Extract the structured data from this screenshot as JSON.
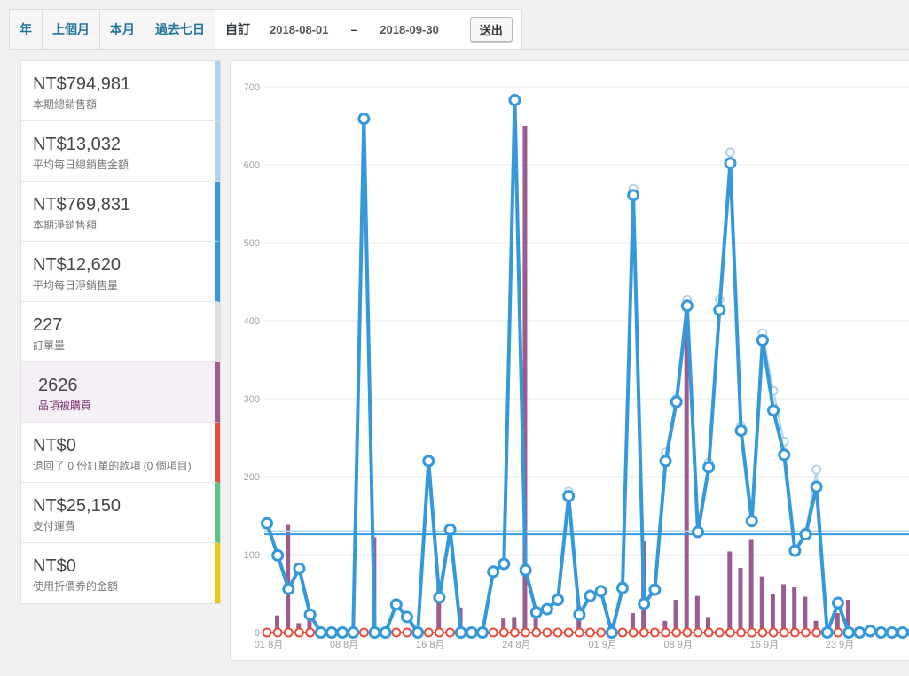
{
  "range_tabs": [
    "年",
    "上個月",
    "本月",
    "過去七日"
  ],
  "custom": {
    "label": "自訂",
    "start_date": "2018-08-01",
    "separator": "–",
    "end_date": "2018-09-30",
    "submit_label": "送出"
  },
  "legend": [
    {
      "value": "NT$794,981",
      "label": "本期總銷售額",
      "color": "#b1d4ea"
    },
    {
      "value": "NT$13,032",
      "label": "平均每日總銷售金額",
      "color": "#b1d4ea"
    },
    {
      "value": "NT$769,831",
      "label": "本期淨銷售額",
      "color": "#3498db"
    },
    {
      "value": "NT$12,620",
      "label": "平均每日淨銷售量",
      "color": "#3498db"
    },
    {
      "value": "227",
      "label": "訂單量",
      "color": "#dbe1e3"
    },
    {
      "value": "2626",
      "label": "品項被購買",
      "color": "#9b5c8f",
      "active": true
    },
    {
      "value": "NT$0",
      "label": "退回了 0 份訂單的款項 (0 個項目)",
      "color": "#e74c3c"
    },
    {
      "value": "NT$25,150",
      "label": "支付運費",
      "color": "#5cc488"
    },
    {
      "value": "NT$0",
      "label": "使用折價券的金額",
      "color": "#f1c40f"
    }
  ],
  "chart_data": {
    "type": "line",
    "y_ticks": [
      0,
      100,
      200,
      300,
      400,
      500,
      600,
      700
    ],
    "ylim": [
      0,
      700
    ],
    "x_tick_labels": [
      "01 8月",
      "08 8月",
      "16 8月",
      "24 8月",
      "01 9月",
      "08 9月",
      "16 9月",
      "23 9月"
    ],
    "x_tick_day_index": [
      0,
      7,
      15,
      23,
      31,
      38,
      46,
      53
    ],
    "series": [
      {
        "type": "line",
        "color": "#b1d4ea",
        "values": [
          141,
          100,
          57,
          83,
          24,
          0,
          0,
          0,
          0,
          660,
          0,
          0,
          37,
          21,
          0,
          221,
          46,
          134,
          0,
          0,
          0,
          80,
          89,
          685,
          82,
          27,
          31,
          44,
          181,
          24,
          49,
          55,
          0,
          60,
          569,
          38,
          57,
          231,
          300,
          427,
          131,
          218,
          427,
          616,
          265,
          145,
          384,
          310,
          245,
          105,
          129,
          209,
          0,
          39,
          0,
          0,
          2,
          0,
          0,
          0,
          0
        ]
      },
      {
        "type": "line",
        "color": "#3498db",
        "values": [
          140,
          99,
          56,
          82,
          23,
          0,
          0,
          0,
          0,
          659,
          0,
          0,
          36,
          20,
          0,
          220,
          45,
          132,
          0,
          0,
          0,
          78,
          88,
          683,
          80,
          26,
          30,
          42,
          175,
          23,
          47,
          53,
          0,
          57,
          561,
          37,
          55,
          220,
          296,
          419,
          129,
          212,
          414,
          602,
          259,
          143,
          375,
          285,
          228,
          105,
          126,
          187,
          0,
          38,
          0,
          0,
          2,
          0,
          0,
          0,
          0
        ]
      },
      {
        "type": "bar",
        "color": "#9b5c8f",
        "values": [
          22,
          138,
          12,
          20,
          0,
          0,
          0,
          0,
          0,
          122,
          0,
          0,
          0,
          0,
          0,
          60,
          5,
          32,
          0,
          0,
          0,
          18,
          20,
          650,
          18,
          0,
          0,
          0,
          34,
          0,
          5,
          12,
          0,
          25,
          117,
          0,
          15,
          42,
          412,
          47,
          20,
          0,
          104,
          83,
          120,
          72,
          50,
          62,
          59,
          46,
          15,
          0,
          25,
          42,
          0,
          0,
          0,
          0,
          0,
          0,
          0
        ]
      },
      {
        "type": "line",
        "color": "#5cc488",
        "values": [
          0,
          0,
          0,
          0,
          0,
          0,
          0,
          0,
          0,
          0,
          0,
          0,
          0,
          0,
          0,
          0,
          0,
          0,
          0,
          0,
          0,
          0,
          0,
          0,
          0,
          0,
          0,
          0,
          0,
          0,
          0,
          0,
          0,
          0,
          0,
          0,
          0,
          0,
          0,
          0,
          0,
          0,
          0,
          0,
          0,
          0,
          0,
          23,
          15,
          12,
          0,
          0,
          22,
          0,
          0,
          0,
          0,
          0,
          0,
          0,
          0
        ]
      },
      {
        "type": "line",
        "color": "#e74c3c",
        "values": [
          0,
          0,
          0,
          0,
          0,
          0,
          0,
          0,
          0,
          0,
          0,
          0,
          0,
          0,
          0,
          0,
          0,
          0,
          0,
          0,
          0,
          0,
          0,
          0,
          0,
          0,
          0,
          0,
          0,
          0,
          0,
          0,
          0,
          0,
          0,
          0,
          0,
          0,
          0,
          0,
          0,
          0,
          0,
          0,
          0,
          0,
          0,
          0,
          0,
          0,
          0,
          0,
          0,
          0,
          0,
          0,
          0,
          0,
          0,
          0,
          0
        ]
      },
      {
        "type": "average",
        "color": "#b1d4ea",
        "value": 130
      },
      {
        "type": "average",
        "color": "#3498db",
        "value": 126
      }
    ]
  }
}
